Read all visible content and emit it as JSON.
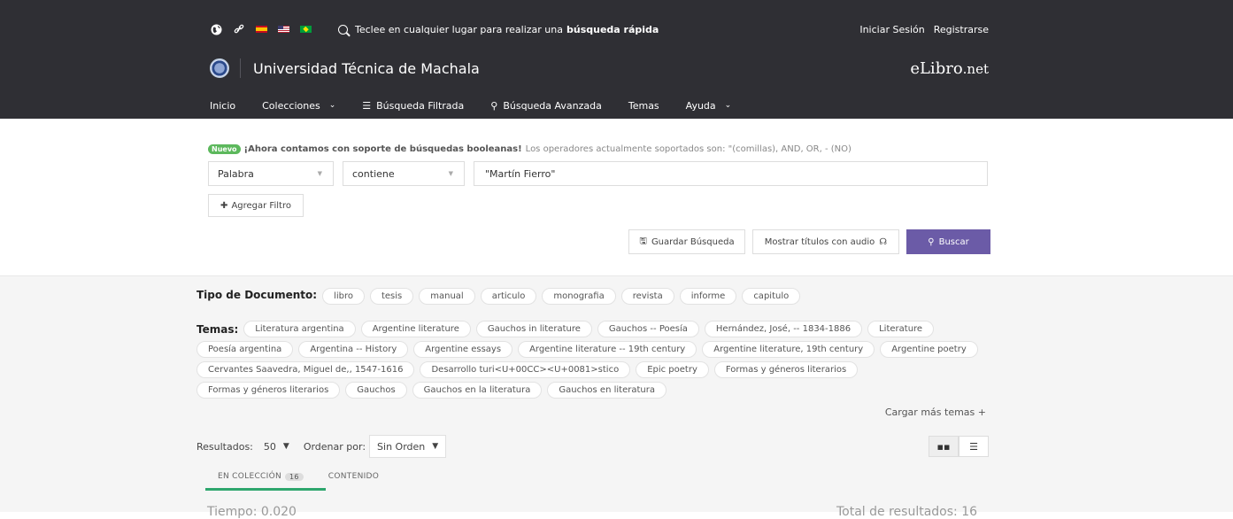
{
  "header": {
    "quick_search_prefix": "Teclee en cualquier lugar para realizar una",
    "quick_search_bold": "búsqueda rápida",
    "login": "Iniciar Sesión",
    "register": "Registrarse",
    "university": "Universidad Técnica de Machala",
    "brand_main": "eLibro",
    "brand_tld": ".net"
  },
  "nav": {
    "inicio": "Inicio",
    "colecciones": "Colecciones",
    "filtrada": "Búsqueda Filtrada",
    "avanzada": "Búsqueda Avanzada",
    "temas": "Temas",
    "ayuda": "Ayuda"
  },
  "notice": {
    "badge": "Nuevo",
    "bold": "¡Ahora contamos con soporte de búsquedas booleanas!",
    "rest": "Los operadores actualmente soportados son: \"(comillas), AND, OR, - (NO)"
  },
  "filter": {
    "field": "Palabra",
    "operator": "contiene",
    "value": "\"Martín Fierro\"",
    "add_filter": "Agregar Filtro"
  },
  "actions": {
    "save": "Guardar Búsqueda",
    "audio": "Mostrar títulos con audio",
    "search": "Buscar"
  },
  "facets": {
    "doc_label": "Tipo de Documento:",
    "doc_types": [
      "libro",
      "tesis",
      "manual",
      "articulo",
      "monografia",
      "revista",
      "informe",
      "capitulo"
    ],
    "temas_label": "Temas:",
    "temas_rows": [
      [
        "Literatura argentina",
        "Argentine literature",
        "Gauchos in literature",
        "Gauchos -- Poesía",
        "Hernández, José, -- 1834-1886",
        "Literature"
      ],
      [
        "Poesía argentina",
        "Argentina -- History",
        "Argentine essays",
        "Argentine literature -- 19th century",
        "Argentine literature, 19th century",
        "Argentine poetry"
      ],
      [
        "Cervantes Saavedra, Miguel de,, 1547-1616",
        "Desarrollo turi<U+00CC><U+0081>stico",
        "Epic poetry",
        "Formas y géneros literarios"
      ],
      [
        "Formas y géneros literarios",
        "Gauchos",
        "Gauchos en la literatura",
        "Gauchos en literatura"
      ]
    ],
    "more": "Cargar más temas +"
  },
  "results": {
    "label": "Resultados:",
    "per_page": "50",
    "order_label": "Ordenar por:",
    "order_value": "Sin Orden"
  },
  "tabs": {
    "collection": "EN COLECCIÓN",
    "collection_count": "16",
    "content": "CONTENIDO"
  },
  "footer_cut": {
    "left": "Tiempo: 0.020",
    "right": "Total de resultados: 16"
  }
}
